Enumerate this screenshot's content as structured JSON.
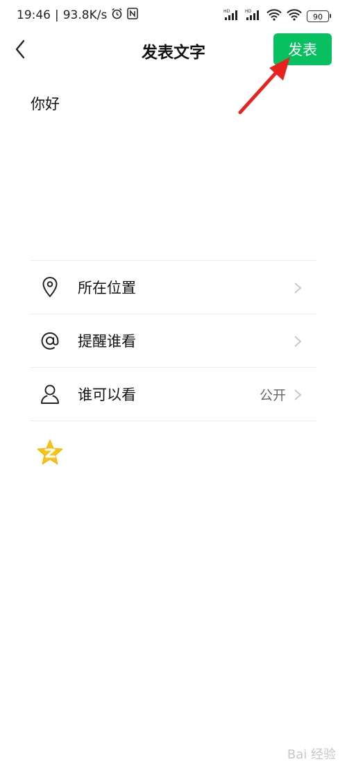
{
  "status_bar": {
    "time": "19:46",
    "separator": "|",
    "speed": "93.8K/s",
    "battery": "90",
    "hd_badge": "HD",
    "icons": [
      "alarm-icon",
      "nfc-icon",
      "signal-icon",
      "wifi-icon",
      "battery-icon"
    ]
  },
  "nav": {
    "title": "发表文字",
    "publish_label": "发表",
    "back_icon": "chevron-left-icon"
  },
  "post": {
    "text": "你好"
  },
  "options": [
    {
      "label": "所在位置",
      "value": "",
      "icon": "location-pin-icon"
    },
    {
      "label": "提醒谁看",
      "value": "",
      "icon": "at-sign-icon"
    },
    {
      "label": "谁可以看",
      "value": "公开",
      "icon": "person-icon"
    }
  ],
  "share": {
    "icon": "qzone-star-icon"
  },
  "watermark": {
    "text": "Bai 经验"
  },
  "colors": {
    "accent": "#07c160",
    "arrow": "#e8221e",
    "qzone": "#f7c31a"
  }
}
